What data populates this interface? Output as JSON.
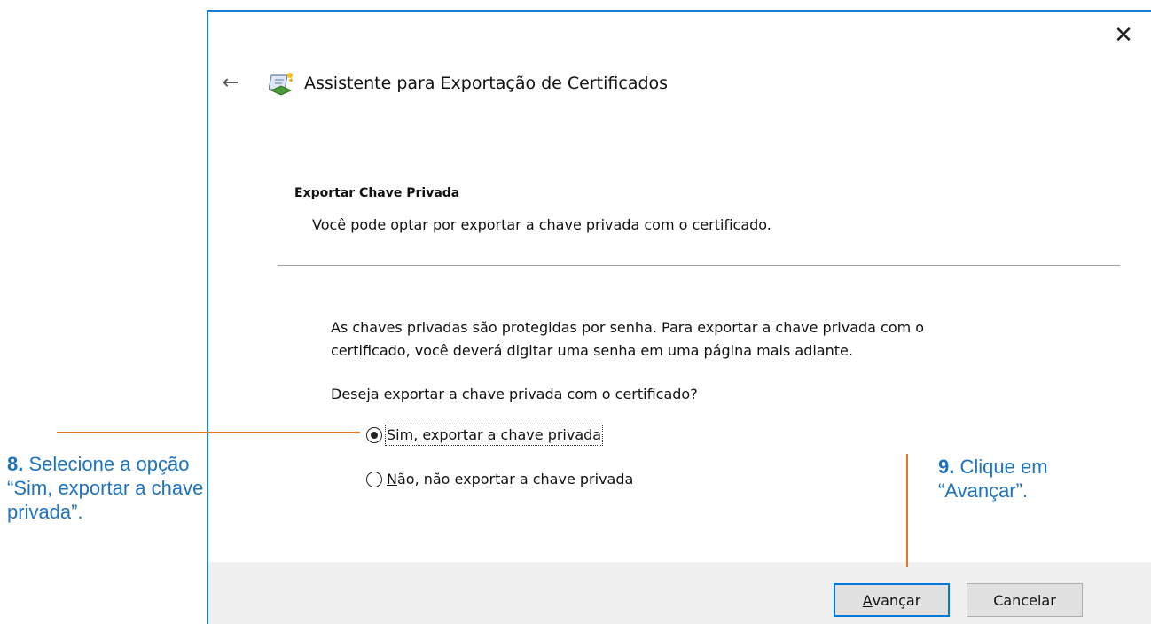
{
  "dialog": {
    "close_glyph": "✕",
    "back_glyph": "←",
    "title": "Assistente para Exportação de Certificados",
    "section_title": "Exportar Chave Privada",
    "section_subtitle": "Você pode optar por exportar a chave privada com o certificado.",
    "description_line1": "As chaves privadas são protegidas por senha. Para exportar a chave privada com o",
    "description_line2": "certificado, você deverá digitar uma senha em uma página mais adiante.",
    "question": "Deseja exportar a chave privada com o certificado?",
    "options": [
      {
        "hotkey": "S",
        "rest": "im, exportar a chave privada",
        "selected": true
      },
      {
        "hotkey": "N",
        "rest": "ão, não exportar a chave privada",
        "selected": false
      }
    ],
    "buttons": {
      "next_hotkey": "A",
      "next_rest": "vançar",
      "cancel": "Cancelar"
    }
  },
  "annotations": {
    "step8_number": "8.",
    "step8_text": " Selecione a opção “Sim, exportar a chave privada”.",
    "step9_number": "9.",
    "step9_text": " Clique em “Avançar”."
  },
  "colors": {
    "dialog_border": "#1e7bd6",
    "annotation_text": "#1e73be",
    "callout_line": "#e07a1f",
    "footer_bg": "#f0f0f0",
    "default_button_border": "#0078d7"
  },
  "icons": {
    "close": "close-icon",
    "back": "back-arrow-icon",
    "wizard": "certificate-wizard-icon"
  }
}
